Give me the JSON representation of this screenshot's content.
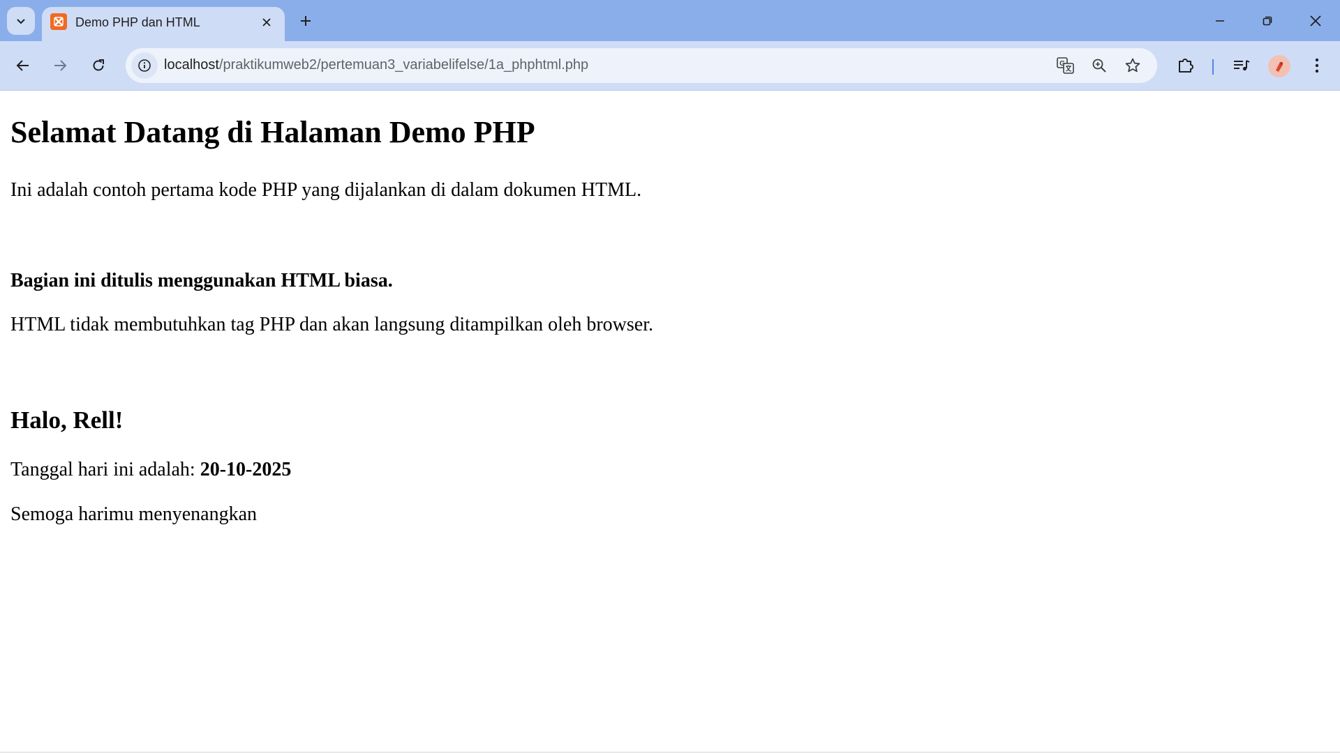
{
  "browser": {
    "tab": {
      "title": "Demo PHP dan HTML"
    },
    "address_bar": {
      "url_host": "localhost",
      "url_path": "/praktikumweb2/pertemuan3_variabelifelse/1a_phphtml.php"
    },
    "theme": {
      "frame_color": "#8aaeea",
      "toolbar_color": "#cfdcf6",
      "favicon_color": "#f06a22"
    },
    "icons": {
      "tab_search": "chevron-down-icon",
      "tab_close": "close-icon",
      "new_tab": "plus-icon",
      "minimize": "minimize-icon",
      "restore": "restore-icon",
      "close_window": "close-icon",
      "back": "arrow-left-icon",
      "forward": "arrow-right-icon",
      "reload": "reload-icon",
      "site_info": "info-icon",
      "translate": "translate-icon",
      "zoom": "zoom-icon",
      "bookmark": "star-icon",
      "extensions": "puzzle-icon",
      "media": "media-queue-icon",
      "menu": "kebab-menu-icon"
    }
  },
  "page": {
    "heading": "Selamat Datang di Halaman Demo PHP",
    "intro": "Ini adalah contoh pertama kode PHP yang dijalankan di dalam dokumen HTML.",
    "html_section": {
      "heading": "Bagian ini ditulis menggunakan HTML biasa.",
      "text": "HTML tidak membutuhkan tag PHP dan akan langsung ditampilkan oleh browser."
    },
    "greeting": {
      "heading": "Halo, Rell!",
      "date_label": "Tanggal hari ini adalah: ",
      "date_value": "20-10-2025",
      "wish": "Semoga harimu menyenangkan"
    }
  }
}
